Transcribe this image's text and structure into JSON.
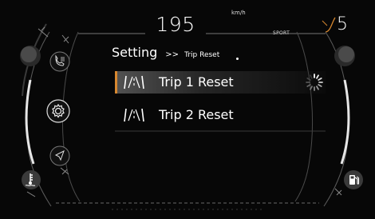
{
  "status": {
    "speed": "195",
    "speed_unit": "km/h",
    "drive_mode": "SPORT",
    "gear": "5"
  },
  "breadcrumb": {
    "main": "Setting",
    "separator": ">>",
    "sub": "Trip Reset"
  },
  "menu": {
    "items": [
      {
        "label": "Trip 1 Reset",
        "selected": true,
        "loading": true
      },
      {
        "label": "Trip 2 Reset",
        "selected": false
      }
    ]
  },
  "icons": {
    "left": [
      "phone-icon",
      "settings-gear-icon",
      "navigation-icon",
      "coolant-temperature-icon"
    ],
    "right": [
      "fuel-pump-icon"
    ],
    "menu_item": "trip-road-icon",
    "loading": "loading-spinner-icon"
  },
  "colors": {
    "accent": "#d7872f",
    "highlight": "#e8e8e8",
    "background": "#070707",
    "text": "#ffffff"
  }
}
